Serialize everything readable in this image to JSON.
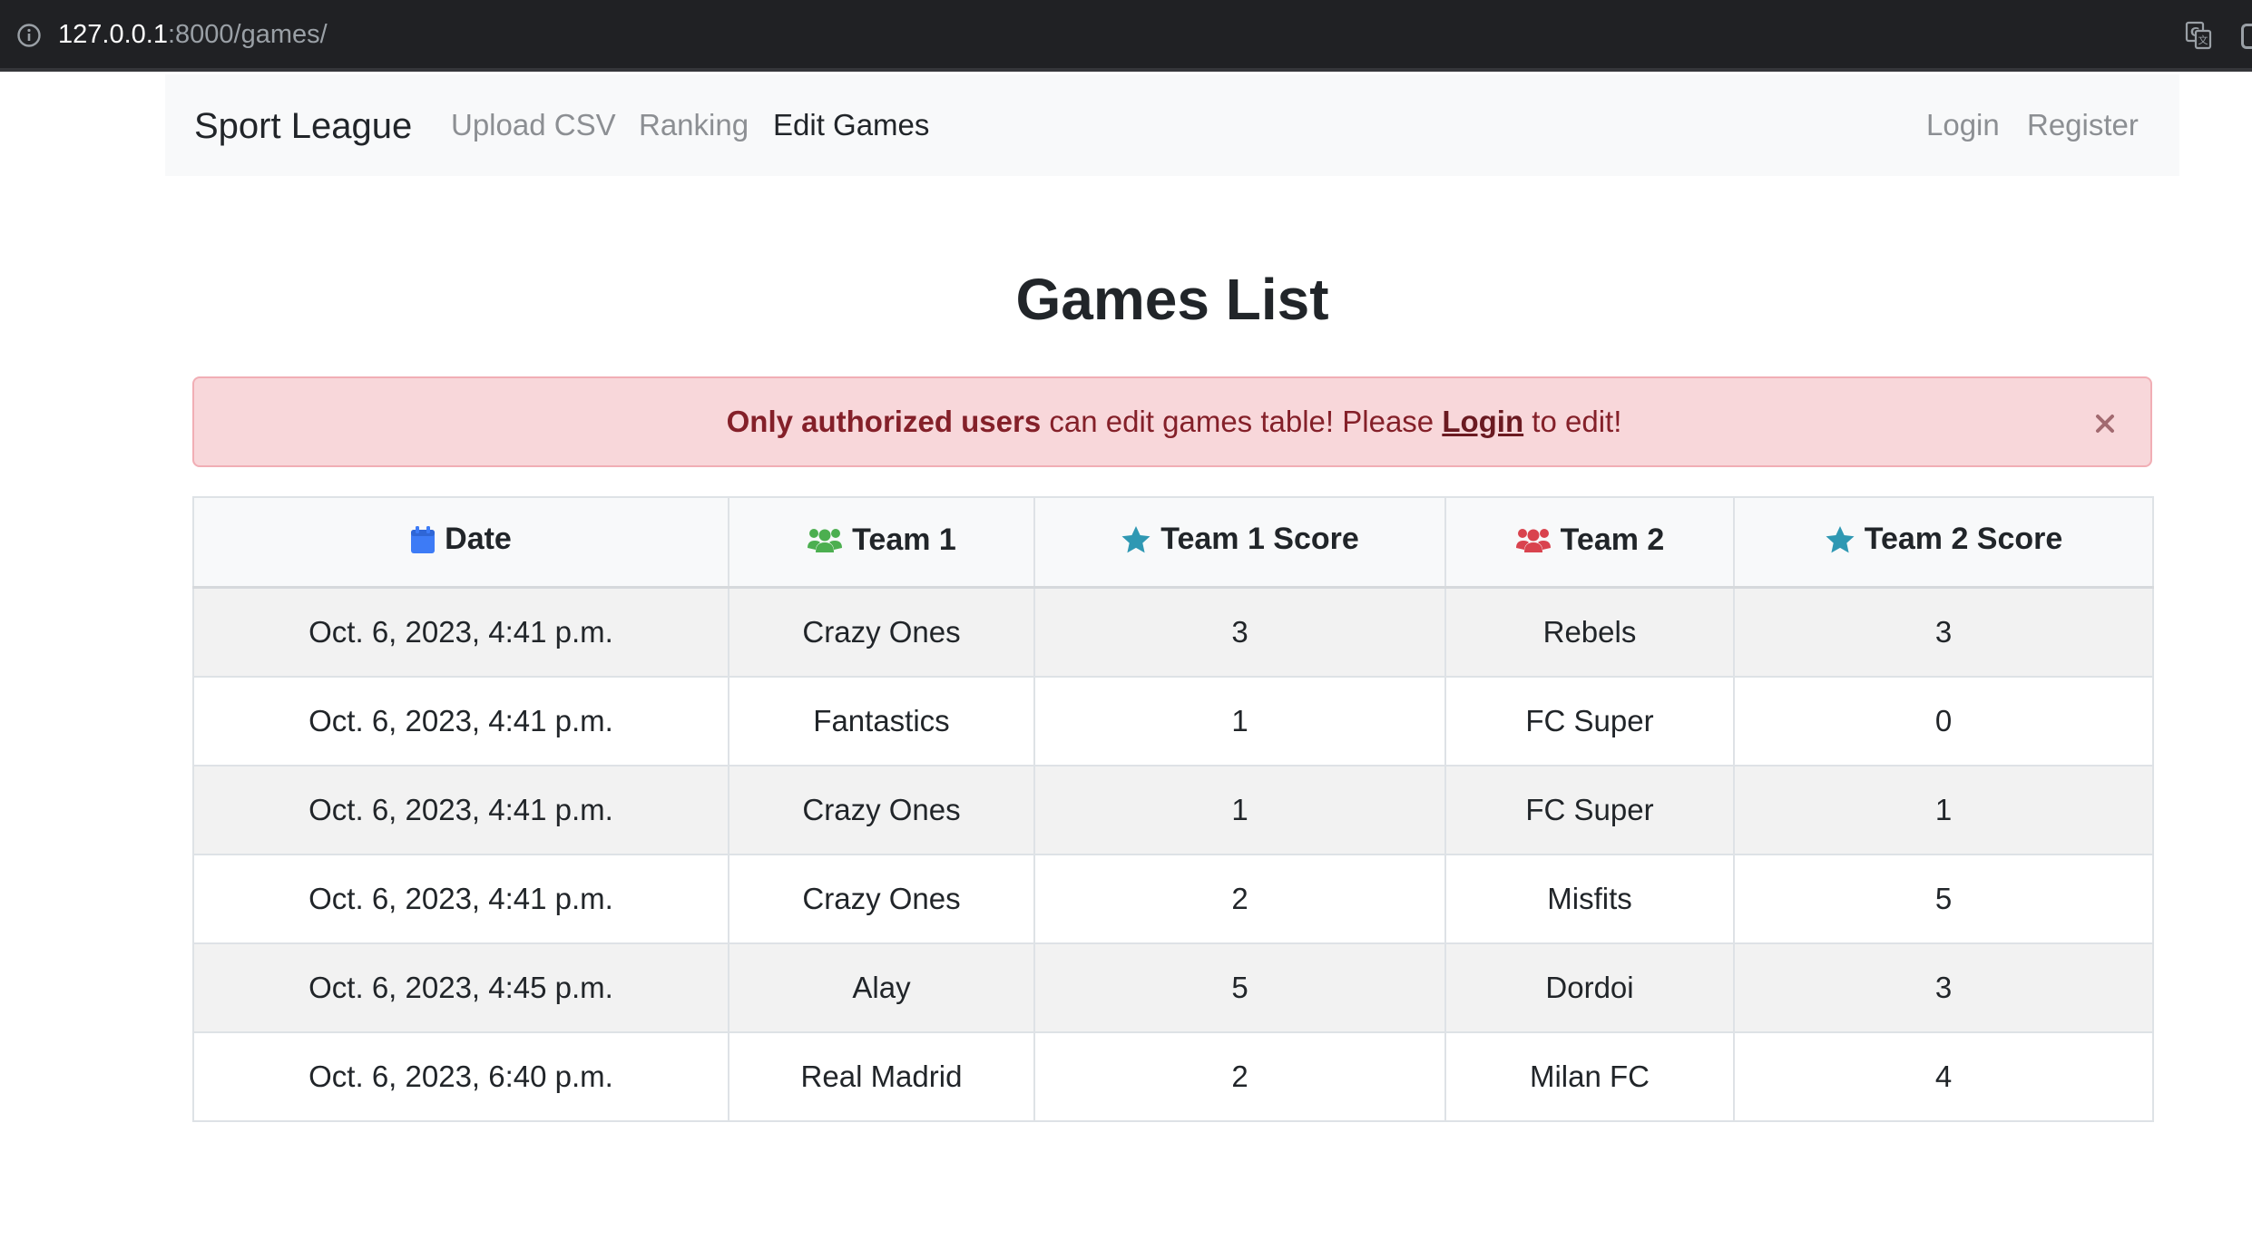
{
  "browser": {
    "url_host": "127.0.0.1",
    "url_path": ":8000/games/",
    "icons": [
      "info-icon",
      "translate-icon"
    ]
  },
  "navbar": {
    "brand": "Sport League",
    "links": [
      {
        "label": "Upload CSV",
        "active": false
      },
      {
        "label": "Ranking",
        "active": false
      },
      {
        "label": "Edit Games",
        "active": true
      }
    ],
    "right_links": [
      {
        "label": "Login"
      },
      {
        "label": "Register"
      }
    ]
  },
  "page": {
    "title": "Games List"
  },
  "alert": {
    "bold_text": "Only authorized users",
    "text_mid": " can edit games table! Please ",
    "link_text": "Login",
    "text_end": " to edit!",
    "close_icon": "close-icon"
  },
  "table": {
    "columns": [
      {
        "label": "Date",
        "icon": "calendar-icon",
        "icon_color": "#3d7bf6"
      },
      {
        "label": "Team 1",
        "icon": "users-icon",
        "icon_color": "#4caf50"
      },
      {
        "label": "Team 1 Score",
        "icon": "star-icon",
        "icon_color": "#2f98b3"
      },
      {
        "label": "Team 2",
        "icon": "users-icon",
        "icon_color": "#d9434e"
      },
      {
        "label": "Team 2 Score",
        "icon": "star-icon",
        "icon_color": "#2f98b3"
      }
    ],
    "rows": [
      [
        "Oct. 6, 2023, 4:41 p.m.",
        "Crazy Ones",
        "3",
        "Rebels",
        "3"
      ],
      [
        "Oct. 6, 2023, 4:41 p.m.",
        "Fantastics",
        "1",
        "FC Super",
        "0"
      ],
      [
        "Oct. 6, 2023, 4:41 p.m.",
        "Crazy Ones",
        "1",
        "FC Super",
        "1"
      ],
      [
        "Oct. 6, 2023, 4:41 p.m.",
        "Crazy Ones",
        "2",
        "Misfits",
        "5"
      ],
      [
        "Oct. 6, 2023, 4:45 p.m.",
        "Alay",
        "5",
        "Dordoi",
        "3"
      ],
      [
        "Oct. 6, 2023, 6:40 p.m.",
        "Real Madrid",
        "2",
        "Milan FC",
        "4"
      ]
    ]
  },
  "colors": {
    "alert_bg": "#f8d7da",
    "alert_text": "#842029",
    "navbar_bg": "#f8f9fa",
    "row_stripe": "#f2f2f2"
  }
}
